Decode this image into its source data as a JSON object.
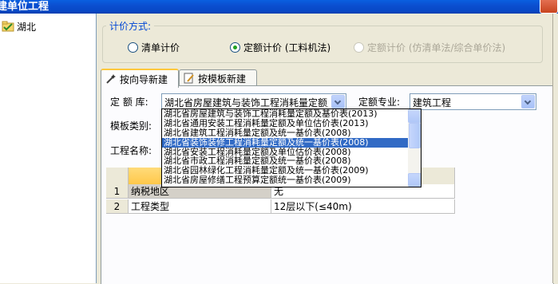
{
  "window": {
    "title": "建单位工程"
  },
  "tree": {
    "root_label": "湖北"
  },
  "pricing": {
    "group_title": "计价方式:",
    "options": [
      {
        "label": "清单计价",
        "selected": false,
        "enabled": true
      },
      {
        "label": "定额计价 (工料机法)",
        "selected": true,
        "enabled": true
      },
      {
        "label": "定额计价 (仿清单法/综合单价法)",
        "selected": false,
        "enabled": false
      }
    ]
  },
  "tabs": [
    {
      "label": "按向导新建",
      "active": true
    },
    {
      "label": "按模板新建",
      "active": false
    }
  ],
  "form": {
    "quota_library_label": "定 额 库:",
    "quota_library_value": "湖北省房屋建筑与装饰工程消耗量定额及",
    "quota_specialty_label": "定额专业:",
    "quota_specialty_value": "建筑工程",
    "template_type_label": "模板类别:",
    "project_name_label": "工程名称:"
  },
  "dropdown": {
    "options": [
      "湖北省房屋建筑与装饰工程消耗量定额及基价表(2013)",
      "湖北省通用安装工程消耗量定额及单位估价表(2013)",
      "湖北省建筑工程消耗量定额及统一基价表(2008)",
      "湖北省装饰装修工程消耗量定额及统一基价表(2008)",
      "湖北省安装工程消耗量定额及单位估价表(2008)",
      "湖北省市政工程消耗量定额及统一基价表(2008)",
      "湖北省园林绿化工程消耗量定额及统一基价表(2009)",
      "湖北省房屋修缮工程预算定额统一基价表(2009)"
    ],
    "selected_index": 3
  },
  "grid": {
    "rows": [
      {
        "num": "1",
        "label": "纳税地区",
        "value": "无"
      },
      {
        "num": "2",
        "label": "工程类型",
        "value": "12层以下(≤40m)"
      }
    ]
  },
  "colors": {
    "titlebar": "#0b4fd0",
    "selection": "#316ac5",
    "group_title": "#0046d5"
  }
}
